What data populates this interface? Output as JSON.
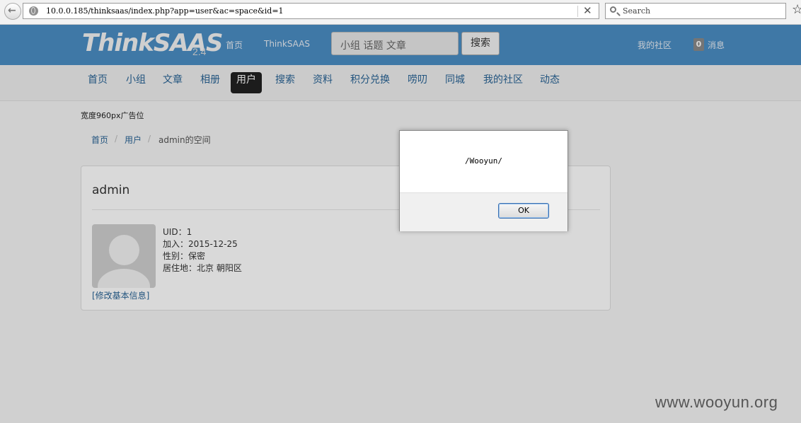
{
  "browser": {
    "url": "10.0.0.185/thinksaas/index.php?app=user&ac=space&id=1",
    "search_placeholder": "Search"
  },
  "site": {
    "logo": "ThinkSAAS",
    "version": "2.4",
    "top_links": [
      "首页",
      "ThinkSAAS"
    ],
    "search_placeholder": "小组 话题 文章",
    "search_button": "搜索",
    "my_community": "我的社区",
    "message_count": "0",
    "message_label": "消息"
  },
  "nav": {
    "items": [
      "首页",
      "小组",
      "文章",
      "相册",
      "用户",
      "搜索",
      "资料",
      "积分兑换",
      "唠叨",
      "同城",
      "我的社区",
      "动态"
    ],
    "active": "用户"
  },
  "ad_text": "宽度960px广告位",
  "breadcrumb": [
    "首页",
    "用户",
    "admin的空间"
  ],
  "profile": {
    "name": "admin",
    "info": [
      "UID：1",
      "加入：2015-12-25",
      "性别：保密",
      "居住地：北京 朝阳区"
    ],
    "edit_link": "[修改基本信息]"
  },
  "alert": {
    "message": "/Wooyun/",
    "ok_label": "OK"
  },
  "watermark": "www.wooyun.org"
}
